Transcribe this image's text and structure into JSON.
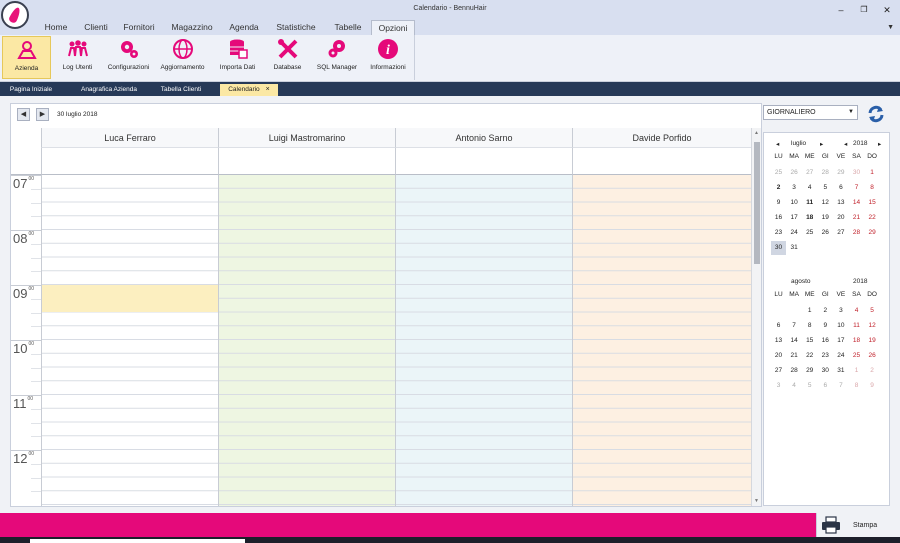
{
  "window": {
    "title": "Calendario - BennuHair",
    "controls": [
      "minimize-icon",
      "restore-icon",
      "close-icon"
    ]
  },
  "menu": {
    "items": [
      "Home",
      "Clienti",
      "Fornitori",
      "Magazzino",
      "Agenda",
      "Statistiche",
      "Tabelle",
      "Opzioni"
    ],
    "active": "Opzioni"
  },
  "ribbon": {
    "buttons": [
      {
        "label": "Azienda",
        "icon": "company-icon"
      },
      {
        "label": "Log Utenti",
        "icon": "users-icon"
      },
      {
        "label": "Configurazioni",
        "icon": "gears-icon"
      },
      {
        "label": "Aggiornamento",
        "icon": "globe-refresh-icon"
      },
      {
        "label": "Importa Dati",
        "icon": "database-import-icon"
      },
      {
        "label": "Database",
        "icon": "tools-icon"
      },
      {
        "label": "SQL Manager",
        "icon": "sql-gears-icon"
      },
      {
        "label": "Informazioni",
        "icon": "info-icon"
      }
    ],
    "active": "Azienda"
  },
  "tabs": {
    "items": [
      "Pagina Iniziale",
      "Anagrafica Azienda",
      "Tabella Clienti",
      "Calendario"
    ],
    "active": "Calendario",
    "close_glyph": "×"
  },
  "calendar": {
    "current_date": "30 luglio 2018",
    "staff": [
      "Luca Ferraro",
      "Luigi Mastromarino",
      "Antonio Sarno",
      "Davide Porfido"
    ],
    "hours": [
      "07",
      "08",
      "09",
      "10",
      "11",
      "12"
    ],
    "minutes_suffix": "00",
    "column_colors": [
      "#ffffff",
      "#eef6e2",
      "#ebf5f8",
      "#fdf0e2"
    ],
    "selection_color": "#fcefc0",
    "selected_slot": {
      "staff": "Luca Ferraro",
      "time": "09:00"
    }
  },
  "view_selector": {
    "value": "GIORNALIERO"
  },
  "mini_calendar": {
    "weekdays": [
      "LU",
      "MA",
      "ME",
      "GI",
      "VE",
      "SA",
      "DO"
    ],
    "months": [
      {
        "name": "luglio",
        "year": "2018",
        "show_nav": true,
        "weeks": [
          [
            "25",
            "26",
            "27",
            "28",
            "29",
            "30",
            "1"
          ],
          [
            "2",
            "3",
            "4",
            "5",
            "6",
            "7",
            "8"
          ],
          [
            "9",
            "10",
            "11",
            "12",
            "13",
            "14",
            "15"
          ],
          [
            "16",
            "17",
            "18",
            "19",
            "20",
            "21",
            "22"
          ],
          [
            "23",
            "24",
            "25",
            "26",
            "27",
            "28",
            "29"
          ],
          [
            "30",
            "31"
          ]
        ],
        "other_month_first_row": 6,
        "bold_days": [
          "2",
          "11",
          "18"
        ],
        "selected_day": "30"
      },
      {
        "name": "agosto",
        "year": "2018",
        "show_nav": false,
        "weeks": [
          [
            "",
            "",
            "1",
            "2",
            "3",
            "4",
            "5"
          ],
          [
            "6",
            "7",
            "8",
            "9",
            "10",
            "11",
            "12"
          ],
          [
            "13",
            "14",
            "15",
            "16",
            "17",
            "18",
            "19"
          ],
          [
            "20",
            "21",
            "22",
            "23",
            "24",
            "25",
            "26"
          ],
          [
            "27",
            "28",
            "29",
            "30",
            "31",
            "1",
            "2"
          ],
          [
            "3",
            "4",
            "5",
            "6",
            "7",
            "8",
            "9"
          ]
        ],
        "other_month_trailing": true,
        "bold_days": [],
        "selected_day": ""
      }
    ]
  },
  "footer": {
    "print_label": "Stampa",
    "accent": "#e5097a"
  }
}
